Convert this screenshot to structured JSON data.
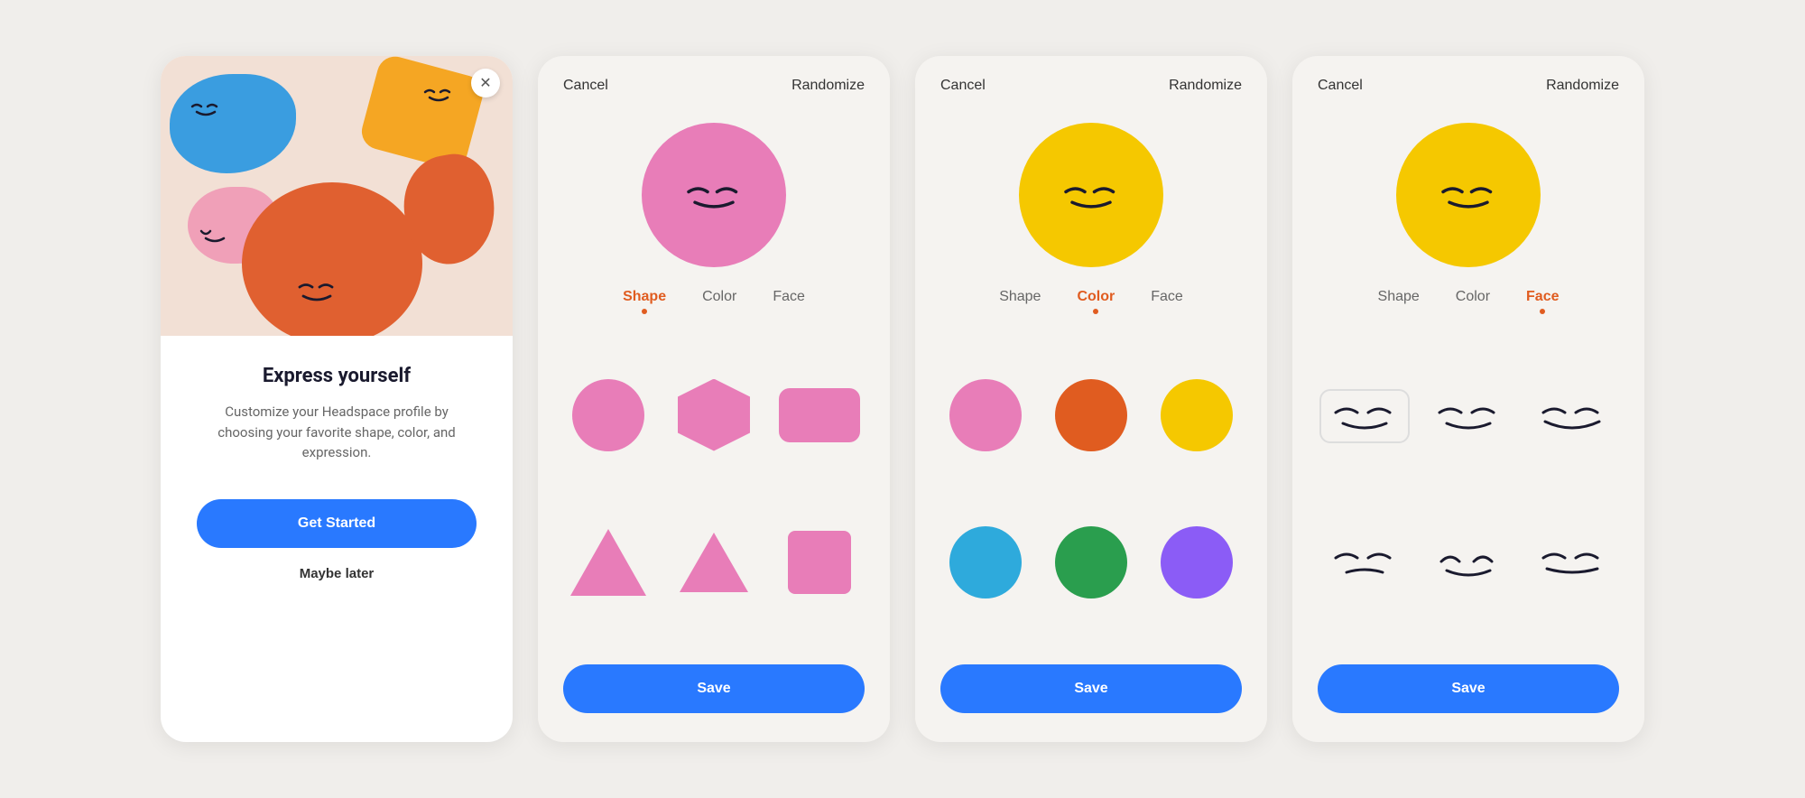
{
  "intro": {
    "title": "Express yourself",
    "description": "Customize your Headspace profile by choosing your favorite shape, color, and expression.",
    "get_started_label": "Get Started",
    "maybe_later_label": "Maybe later"
  },
  "customizer": {
    "cancel_label": "Cancel",
    "randomize_label": "Randomize",
    "save_label": "Save",
    "tabs": [
      {
        "id": "shape",
        "label": "Shape"
      },
      {
        "id": "color",
        "label": "Color"
      },
      {
        "id": "face",
        "label": "Face"
      }
    ],
    "screen1": {
      "active_tab": "shape",
      "avatar_color": "#e87db8",
      "shapes": [
        {
          "type": "circle",
          "color": "#e87db8"
        },
        {
          "type": "hexagon",
          "color": "#e87db8"
        },
        {
          "type": "rect",
          "color": "#e87db8"
        },
        {
          "type": "triangle-up",
          "color": "#e87db8"
        },
        {
          "type": "triangle-small",
          "color": "#e87db8"
        },
        {
          "type": "square",
          "color": "#e87db8"
        }
      ]
    },
    "screen2": {
      "active_tab": "color",
      "avatar_color": "#f5c800",
      "colors": [
        "#e87db8",
        "#e05c20",
        "#f5c800",
        "#2eaadc",
        "#2a9e4e",
        "#8b5cf6"
      ]
    },
    "screen3": {
      "active_tab": "face",
      "avatar_color": "#f5c800",
      "faces": [
        "happy-closed",
        "content-closed",
        "wide-smile",
        "gentle-smile",
        "big-smile",
        "minimal"
      ]
    }
  },
  "colors": {
    "accent_orange": "#e05c20",
    "btn_blue": "#2979ff",
    "pink_avatar": "#e87db8",
    "yellow_avatar": "#f5c800"
  }
}
